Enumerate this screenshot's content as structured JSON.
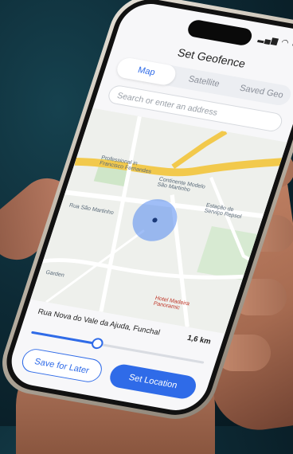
{
  "app": {
    "title": "Set Geofence"
  },
  "tabs": [
    {
      "label": "Map",
      "active": true
    },
    {
      "label": "Satellite",
      "active": false
    },
    {
      "label": "Saved Geo",
      "active": false
    }
  ],
  "search": {
    "placeholder": "Search or enter an address"
  },
  "map": {
    "labels": {
      "place1": "Professional in\nFrancisco Fernandes",
      "place2": "Continente Modelo\nSão Martinho",
      "place3": "Estação de\nServiço Repsol",
      "place4": "Rua São Martinho",
      "place5": "Hotel Madeira\nPanoramic",
      "place6": "Garden"
    },
    "accent_color": "#2f6be8",
    "geofence_color": "#5288f0"
  },
  "location": {
    "address": "Rua Nova do Vale da Ajuda, Funchal",
    "distance": "1,6 km"
  },
  "radius": {
    "fraction": 0.38
  },
  "actions": {
    "save_later": "Save for Later",
    "set_location": "Set Location"
  },
  "status": {
    "icons": "signal wifi battery"
  }
}
